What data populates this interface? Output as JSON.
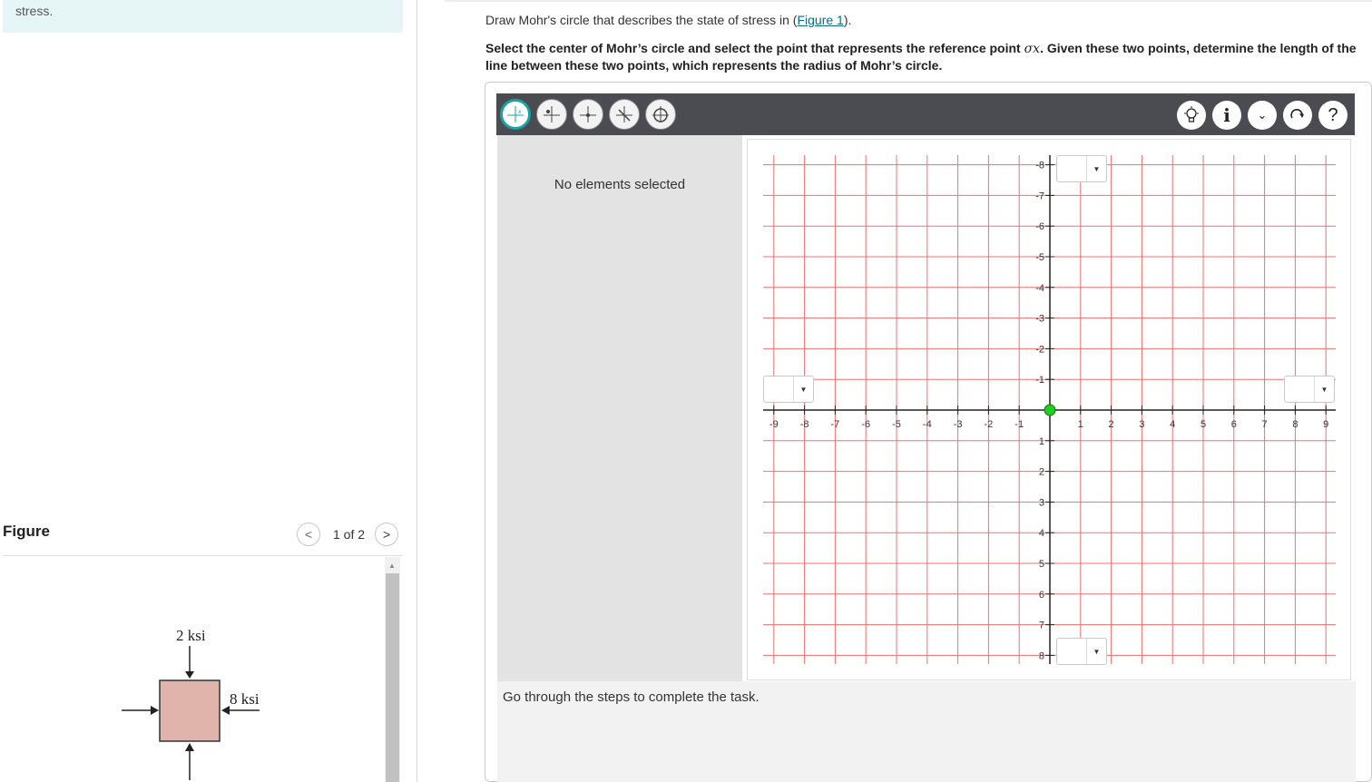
{
  "left": {
    "intro_text": "stress.",
    "figure_title": "Figure",
    "figure_nav": {
      "prev": "<",
      "count": "1 of 2",
      "next": ">"
    },
    "figure_labels": {
      "top": "2 ksi",
      "right": "8 ksi"
    }
  },
  "instructions": {
    "line1_pre": "Draw Mohr's circle that describes the state of stress in (",
    "line1_link": "Figure 1",
    "line1_post": ").",
    "line2_pre": "Select the center of Mohr’s circle and select the point that represents the reference point ",
    "line2_math": "σx",
    "line2_post": ". Given these two points, determine the length of the line between these two points, which represents the radius of Mohr’s circle."
  },
  "toolbar": {
    "tools": [
      "select-tool",
      "point-tool",
      "center-tool",
      "line-tool",
      "circle-tool"
    ],
    "right_tools": [
      "hint-icon",
      "info-icon",
      "chevron-down-icon",
      "redo-icon",
      "help-icon"
    ]
  },
  "side_panel": {
    "message": "No elements selected"
  },
  "bottom_panel": {
    "message": "Go through the steps to complete the task."
  },
  "graph": {
    "x_ticks": [
      "-9",
      "-8",
      "-7",
      "-6",
      "-5",
      "-4",
      "-3",
      "-2",
      "-1",
      "1",
      "2",
      "3",
      "4",
      "5",
      "6",
      "7",
      "8",
      "9"
    ],
    "y_ticks": [
      "-8",
      "-7",
      "-6",
      "-5",
      "-4",
      "-3",
      "-2",
      "-1",
      "1",
      "2",
      "3",
      "4",
      "5",
      "6",
      "7",
      "8"
    ],
    "grid_color": "#f07070",
    "axis_color": "#222222",
    "origin_point_color": "#22cc22"
  },
  "colors": {
    "accent": "#1aa3a3",
    "toolbar_bg": "#4b4b52",
    "stress_block": "#e0b4ab"
  }
}
